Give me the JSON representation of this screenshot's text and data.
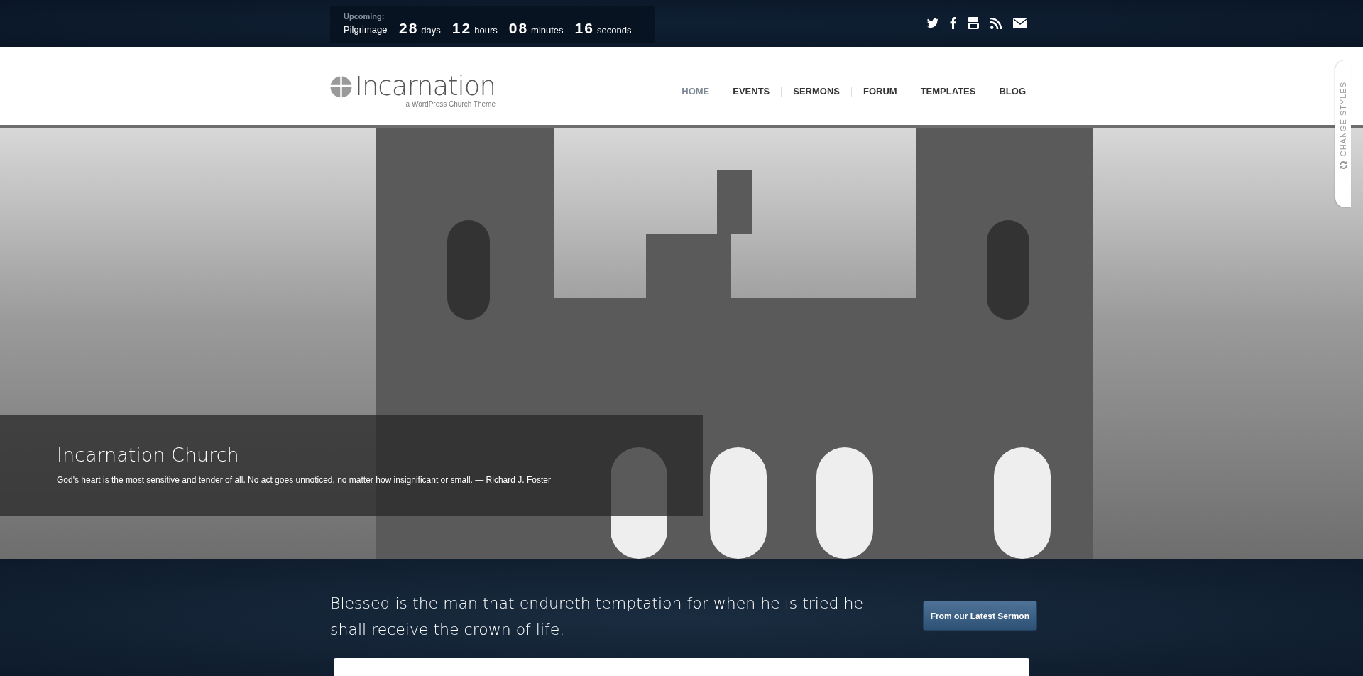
{
  "countdown": {
    "label": "Upcoming:",
    "event": "Pilgrimage",
    "units": [
      {
        "value": "28",
        "unit": "days"
      },
      {
        "value": "12",
        "unit": "hours"
      },
      {
        "value": "08",
        "unit": "minutes"
      },
      {
        "value": "16",
        "unit": "seconds"
      }
    ]
  },
  "header": {
    "logo": "Incarnation",
    "tagline": "a WordPress Church Theme",
    "nav": [
      {
        "label": "HOME",
        "selected": true
      },
      {
        "label": "EVENTS",
        "selected": false
      },
      {
        "label": "SERMONS",
        "selected": false
      },
      {
        "label": "FORUM",
        "selected": false
      },
      {
        "label": "TEMPLATES",
        "selected": false
      },
      {
        "label": "BLOG",
        "selected": false
      }
    ]
  },
  "hero": {
    "title": "Incarnation Church",
    "quote": "God's heart is the most sensitive and tender of all. No act goes unnoticed, no matter how insignificant or small. — Richard J. Foster"
  },
  "side_tab": {
    "label": "CHANGE STYLES"
  },
  "banner": {
    "text": "Blessed is the man that endureth temptation for when he is tried he shall receive the crown of life.",
    "button": "From our Latest Sermon"
  }
}
